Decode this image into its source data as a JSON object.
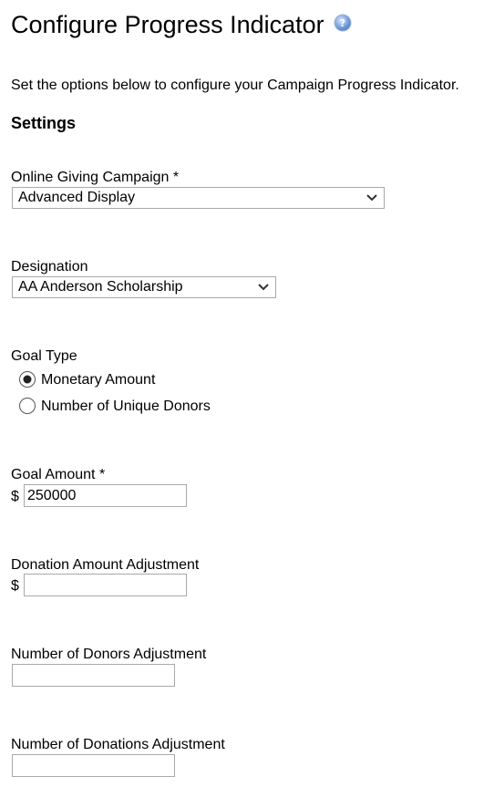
{
  "page": {
    "title": "Configure Progress Indicator",
    "help_icon": "help-question-icon",
    "intro": "Set the options below to configure your Campaign Progress Indicator.",
    "section_heading": "Settings"
  },
  "campaign": {
    "label": "Online Giving Campaign *",
    "selected": "Advanced Display"
  },
  "designation": {
    "label": "Designation",
    "selected": "AA Anderson Scholarship"
  },
  "goal_type": {
    "label": "Goal Type",
    "options": [
      {
        "label": "Monetary Amount",
        "selected": true
      },
      {
        "label": "Number of Unique Donors",
        "selected": false
      }
    ]
  },
  "goal_amount": {
    "label": "Goal Amount *",
    "currency": "$",
    "value": "250000"
  },
  "donation_amount_adjustment": {
    "label": "Donation Amount Adjustment",
    "currency": "$",
    "value": ""
  },
  "donors_adjustment": {
    "label": "Number of Donors Adjustment",
    "value": ""
  },
  "donations_adjustment": {
    "label": "Number of Donations Adjustment",
    "value": ""
  },
  "colors": {
    "border": "#a9a9a9",
    "help_icon": "#5b8fd6",
    "text": "#000000"
  }
}
